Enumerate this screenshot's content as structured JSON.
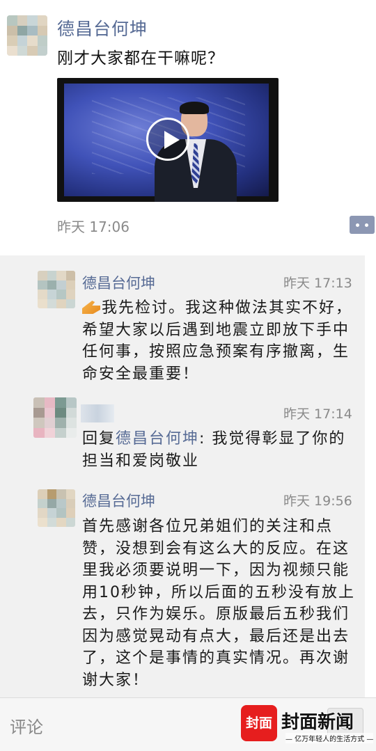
{
  "post": {
    "author": "德昌台何坤",
    "text": "刚才大家都在干嘛呢？",
    "time": "昨天 17:06"
  },
  "comments": [
    {
      "author": "德昌台何坤",
      "time": "昨天 17:13",
      "text": "我先检讨。我这种做法其实不好，希望大家以后遇到地震立即放下手中任何事，按照应急预案有序撤离，生命安全最重要！"
    },
    {
      "time": "昨天 17:14",
      "reply_prefix": "回复",
      "reply_to": "德昌台何坤",
      "text": ": 我觉得彰显了你的担当和爱岗敬业"
    },
    {
      "author": "德昌台何坤",
      "time": "昨天 19:56",
      "text": "首先感谢各位兄弟姐们的关注和点赞，没想到会有这么大的反应。在这里我必须要说明一下，因为视频只能用10秒钟，所以后面的五秒没有放上去，只作为娱乐。原版最后五秒我们因为感觉晃动有点大，最后还是出去了，这个是事情的真实情况。再次谢谢大家！"
    }
  ],
  "bottom_bar": {
    "input_placeholder": "评论",
    "emoji_label": "☺"
  },
  "watermark": {
    "logo": "封面",
    "name": "封面新闻",
    "tagline": "— 亿万年轻人的生活方式 —"
  },
  "colors": {
    "name_link": "#576b95",
    "comment_bg": "#f1f1f1",
    "watermark_red": "#e61e1e"
  }
}
